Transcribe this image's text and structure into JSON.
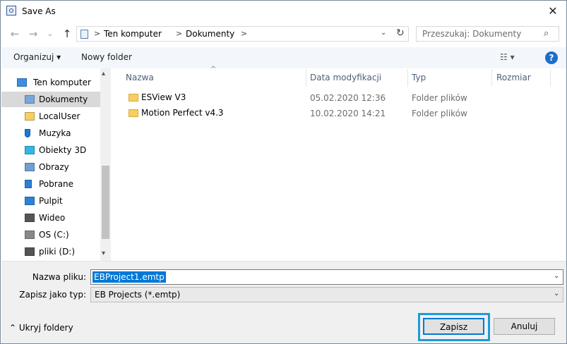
{
  "window": {
    "title": "Save As",
    "close_glyph": "✕"
  },
  "nav": {
    "back_glyph": "←",
    "forward_glyph": "→",
    "recent_glyph": "⌄",
    "up_glyph": "↑",
    "breadcrumb": [
      "Ten komputer",
      "Dokumenty"
    ],
    "breadcrumb_sep": ">",
    "dropdown_glyph": "⌄",
    "refresh_glyph": "↻",
    "search_placeholder": "Przeszukaj: Dokumenty",
    "search_glyph": "⌕"
  },
  "toolbar": {
    "organize_label": "Organizuj ▾",
    "new_folder_label": "Nowy folder",
    "view_glyph": "☷ ▾",
    "help_glyph": "?"
  },
  "sidebar": {
    "items": [
      {
        "label": "Ten komputer",
        "icon": "computer-icon",
        "color": "#3a8ee6"
      },
      {
        "label": "Dokumenty",
        "icon": "document-icon",
        "color": "#7aa7d8"
      },
      {
        "label": "LocalUser",
        "icon": "user-folder-icon",
        "color": "#f6cf60"
      },
      {
        "label": "Muzyka",
        "icon": "music-icon",
        "color": "#1c78d4"
      },
      {
        "label": "Obiekty 3D",
        "icon": "cube-icon",
        "color": "#33b6e6"
      },
      {
        "label": "Obrazy",
        "icon": "picture-icon",
        "color": "#6fa0d0"
      },
      {
        "label": "Pobrane",
        "icon": "download-icon",
        "color": "#2f7fd0"
      },
      {
        "label": "Pulpit",
        "icon": "desktop-icon",
        "color": "#2b82d9"
      },
      {
        "label": "Wideo",
        "icon": "film-icon",
        "color": "#555555"
      },
      {
        "label": "OS (C:)",
        "icon": "drive-icon",
        "color": "#888888"
      },
      {
        "label": "pliki (D:)",
        "icon": "drive-icon",
        "color": "#555555"
      }
    ],
    "selected_index": 1,
    "scroll_up_glyph": "▴",
    "scroll_down_glyph": "▾"
  },
  "filelist": {
    "columns": [
      "Nazwa",
      "Data modyfikacji",
      "Typ",
      "Rozmiar"
    ],
    "sort_glyph": "^",
    "rows": [
      {
        "name": "ESView V3",
        "modified": "05.02.2020 12:36",
        "type": "Folder plików",
        "size": ""
      },
      {
        "name": "Motion Perfect v4.3",
        "modified": "10.02.2020 14:21",
        "type": "Folder plików",
        "size": ""
      }
    ]
  },
  "form": {
    "filename_label": "Nazwa pliku:",
    "filename_value": "EBProject1.emtp",
    "filetype_label": "Zapisz jako typ:",
    "filetype_value": "EB Projects (*.emtp)",
    "dropdown_glyph": "⌄"
  },
  "footer": {
    "hide_folders_label": "⌃  Ukryj foldery",
    "save_label": "Zapisz",
    "cancel_label": "Anuluj"
  },
  "colors": {
    "accent": "#0078d7",
    "highlight_border": "#1d9bd6",
    "help": "#1c6fc9"
  }
}
